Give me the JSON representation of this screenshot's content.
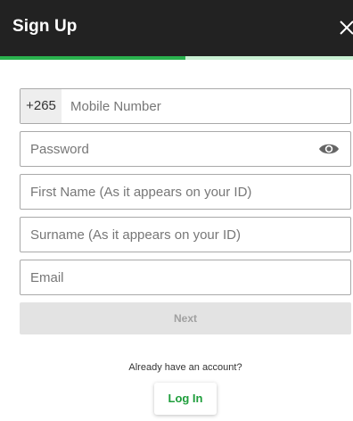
{
  "header": {
    "title": "Sign Up",
    "close_icon": "close-icon"
  },
  "progress": {
    "fraction": 0.525,
    "fill_color": "#2ab24e",
    "track_color": "#c9f0d3"
  },
  "form": {
    "country_code": "+265",
    "mobile_placeholder": "Mobile Number",
    "password_placeholder": "Password",
    "password_toggle_icon": "eye-icon",
    "first_name_placeholder": "First Name (As it appears on your ID)",
    "surname_placeholder": "Surname (As it appears on your ID)",
    "email_placeholder": "Email",
    "next_label": "Next"
  },
  "footer": {
    "prompt": "Already have an account?",
    "login_label": "Log In"
  },
  "colors": {
    "header_bg": "#222222",
    "accent": "#2ab24e",
    "login_text": "#1f9e3c",
    "disabled_button_bg": "#e3e3e3"
  }
}
